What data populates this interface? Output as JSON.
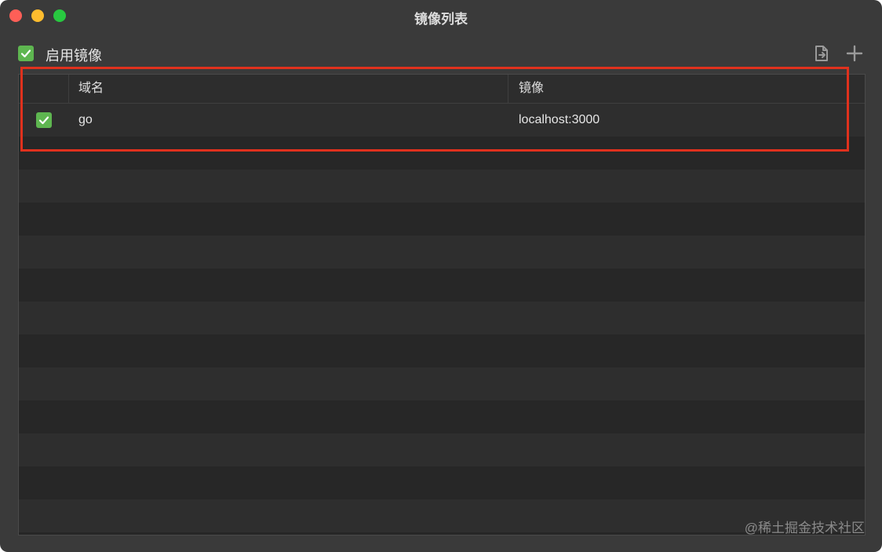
{
  "window": {
    "title": "镜像列表"
  },
  "enable_mirror": {
    "label": "启用镜像",
    "checked": true
  },
  "toolbar": {
    "icons": [
      "import-file-icon",
      "plus-icon"
    ]
  },
  "table": {
    "columns": [
      "",
      "域名",
      "镜像"
    ],
    "rows": [
      {
        "enabled": true,
        "domain": "go",
        "mirror": "localhost:3000"
      }
    ]
  },
  "watermark": "@稀土掘金技术社区",
  "colors": {
    "window_bg": "#3a3a3a",
    "checkbox_green": "#5eb650",
    "highlight_red": "#e0311d"
  }
}
